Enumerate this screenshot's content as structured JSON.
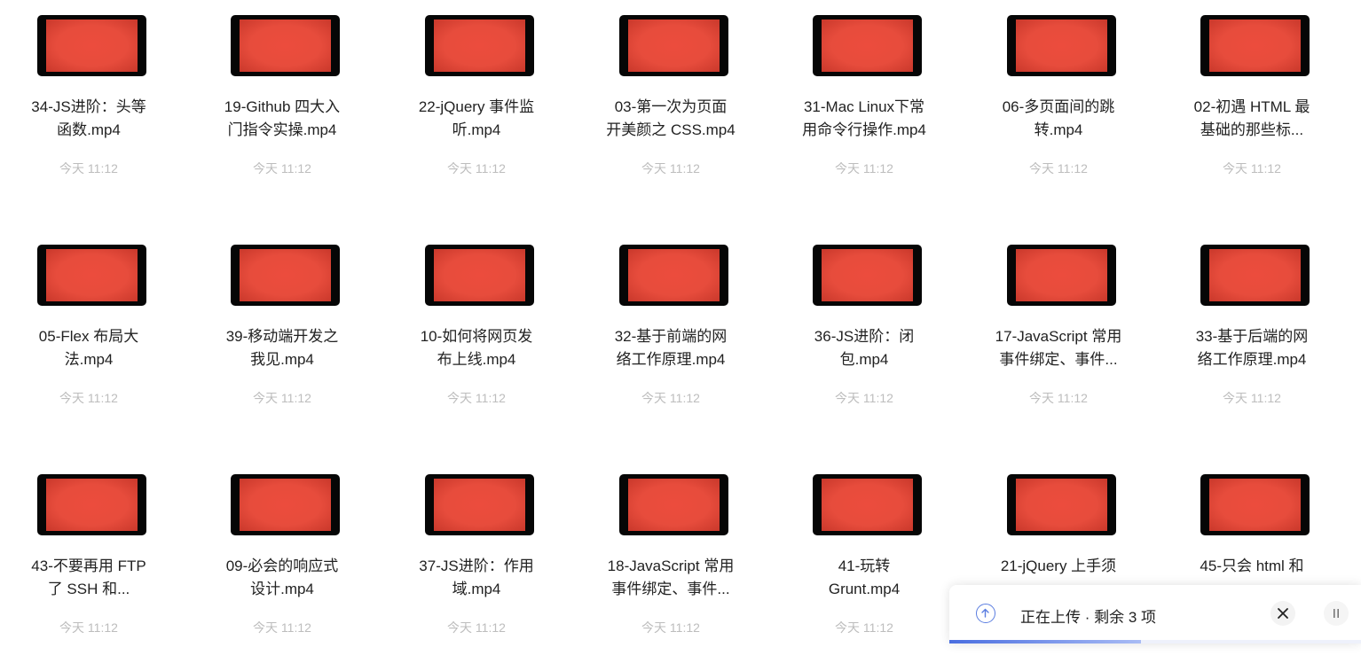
{
  "files": [
    {
      "name": "34-JS进阶：头等\n函数.mp4",
      "time": "今天 11:12"
    },
    {
      "name": "19-Github 四大入\n门指令实操.mp4",
      "time": "今天 11:12"
    },
    {
      "name": "22-jQuery 事件监\n听.mp4",
      "time": "今天 11:12"
    },
    {
      "name": "03-第一次为页面\n开美颜之 CSS.mp4",
      "time": "今天 11:12"
    },
    {
      "name": "31-Mac Linux下常\n用命令行操作.mp4",
      "time": "今天 11:12"
    },
    {
      "name": "06-多页面间的跳\n转.mp4",
      "time": "今天 11:12"
    },
    {
      "name": "02-初遇 HTML 最\n基础的那些标...",
      "time": "今天 11:12"
    },
    {
      "name": "05-Flex 布局大\n法.mp4",
      "time": "今天 11:12"
    },
    {
      "name": "39-移动端开发之\n我见.mp4",
      "time": "今天 11:12"
    },
    {
      "name": "10-如何将网页发\n布上线.mp4",
      "time": "今天 11:12"
    },
    {
      "name": "32-基于前端的网\n络工作原理.mp4",
      "time": "今天 11:12"
    },
    {
      "name": "36-JS进阶：闭\n包.mp4",
      "time": "今天 11:12"
    },
    {
      "name": "17-JavaScript 常用\n事件绑定、事件...",
      "time": "今天 11:12"
    },
    {
      "name": "33-基于后端的网\n络工作原理.mp4",
      "time": "今天 11:12"
    },
    {
      "name": "43-不要再用 FTP\n了 SSH 和...",
      "time": "今天 11:12"
    },
    {
      "name": "09-必会的响应式\n设计.mp4",
      "time": "今天 11:12"
    },
    {
      "name": "37-JS进阶：作用\n域.mp4",
      "time": "今天 11:12"
    },
    {
      "name": "18-JavaScript 常用\n事件绑定、事件...",
      "time": "今天 11:12"
    },
    {
      "name": "41-玩转\nGrunt.mp4",
      "time": "今天 11:12"
    },
    {
      "name": "21-jQuery 上手须",
      "time": ""
    },
    {
      "name": "45-只会 html 和",
      "time": ""
    }
  ],
  "upload": {
    "status": "正在上传 · 剩余 3 项",
    "icon": "upload-arrow-icon",
    "progress": 0.465,
    "accent": "#4a6ee0"
  },
  "colors": {
    "thumbnail_bg": "#060606",
    "thumbnail_fill": "#e74c3c",
    "time_text": "#bdbdbd"
  }
}
